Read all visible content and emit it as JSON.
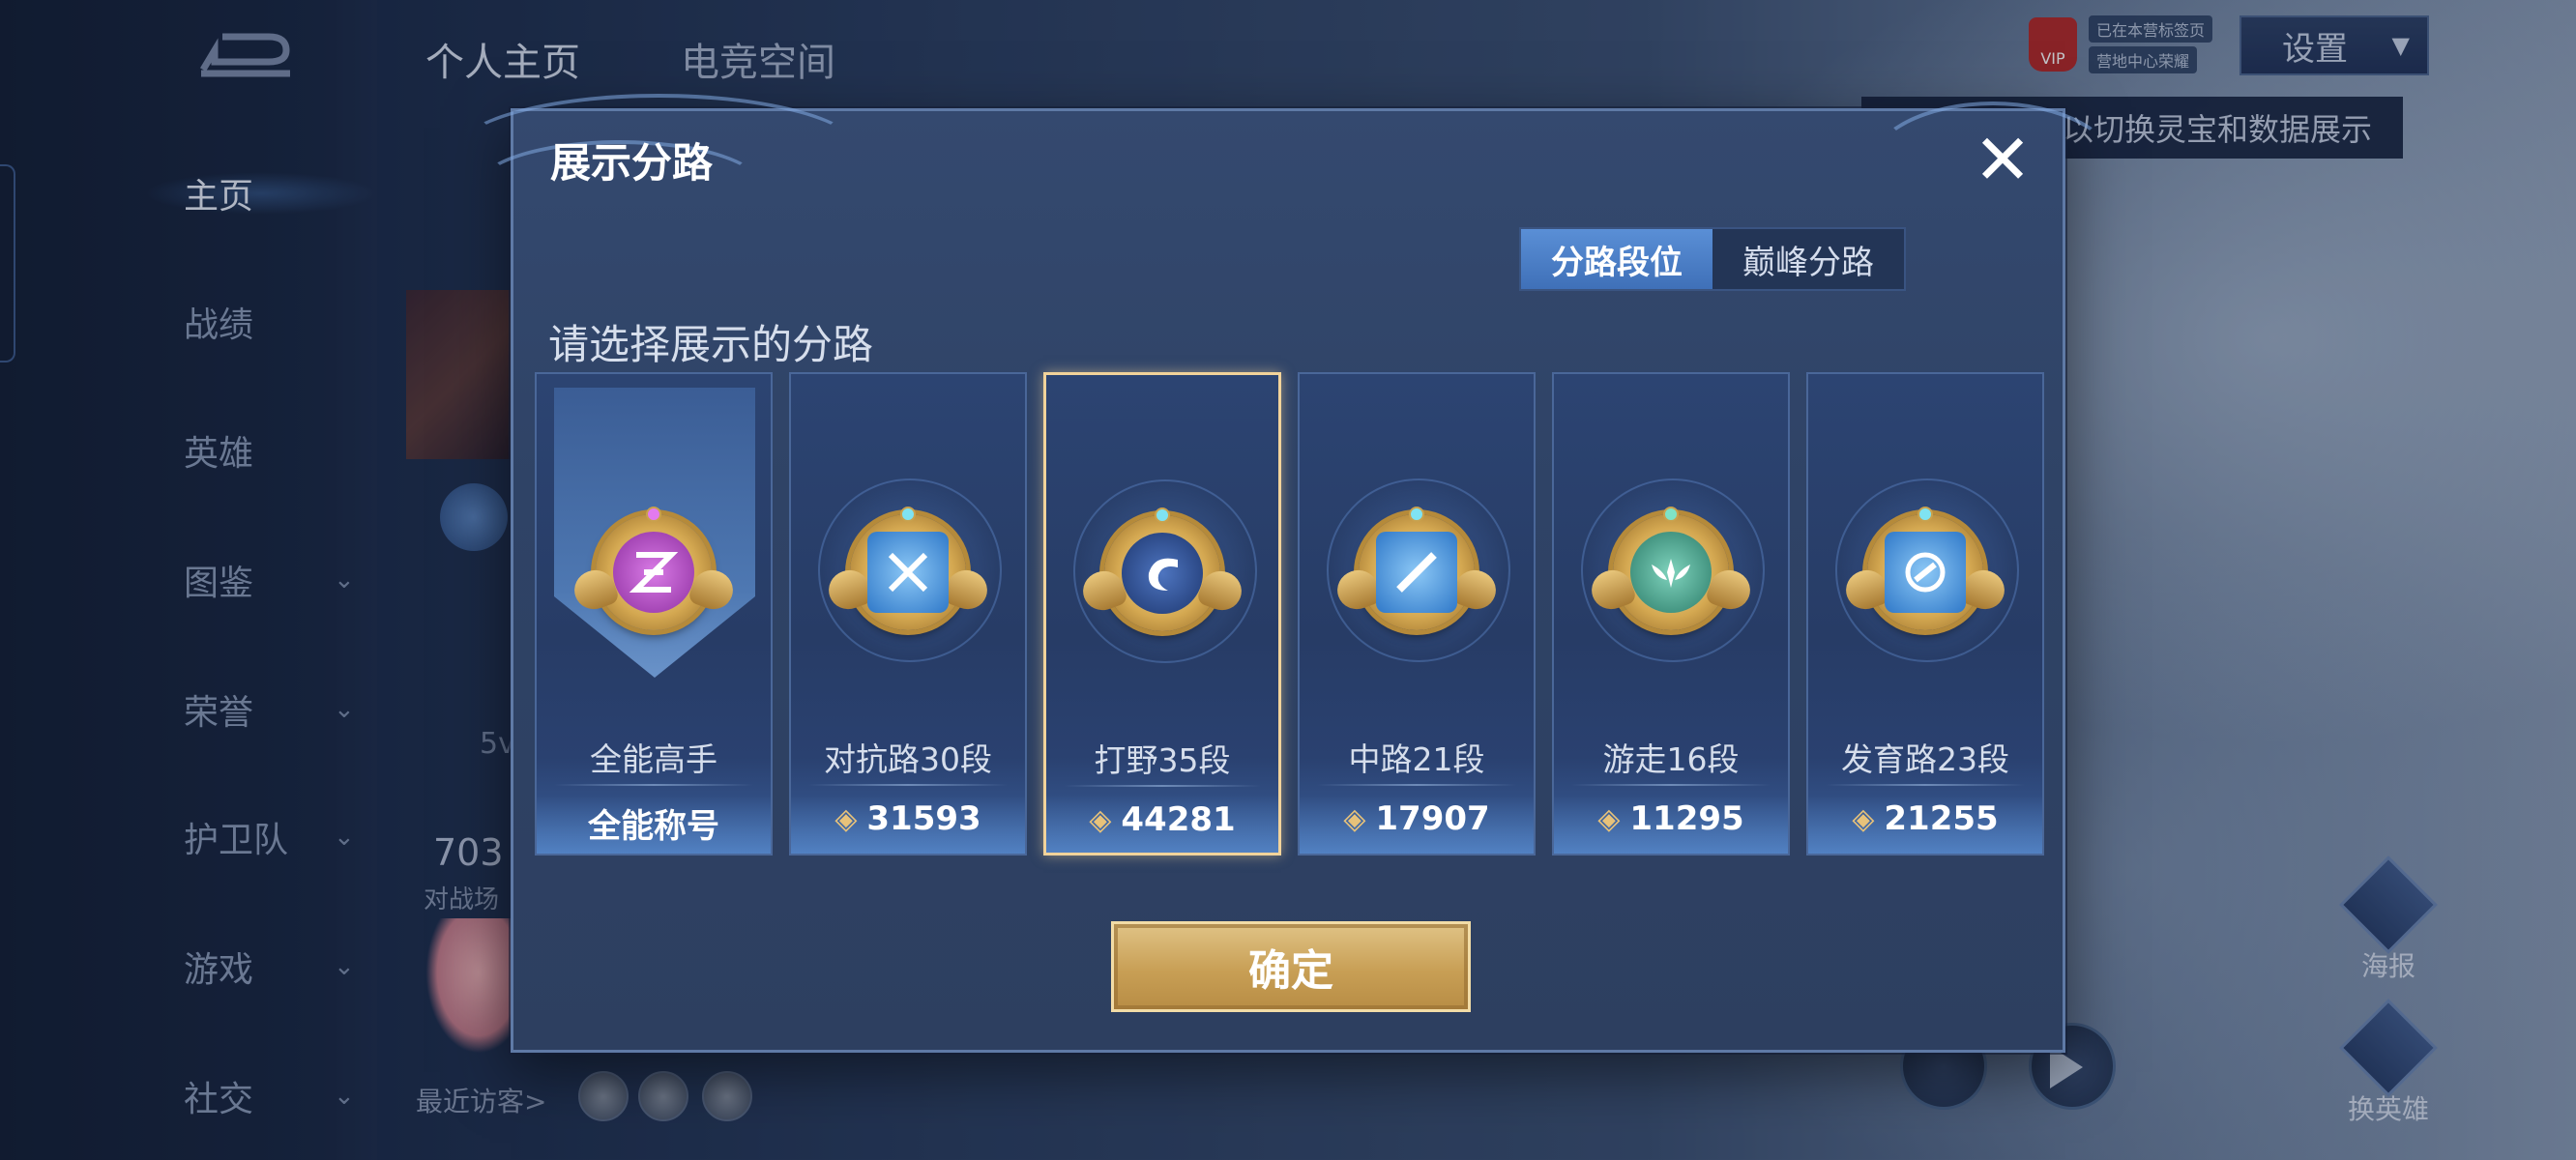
{
  "top_tabs": [
    "个人主页",
    "电竞空间"
  ],
  "nav": [
    {
      "label": "主页",
      "active": true,
      "chevron": false
    },
    {
      "label": "战绩",
      "active": false,
      "chevron": false
    },
    {
      "label": "英雄",
      "active": false,
      "chevron": false
    },
    {
      "label": "图鉴",
      "active": false,
      "chevron": true
    },
    {
      "label": "荣誉",
      "active": false,
      "chevron": true
    },
    {
      "label": "护卫队",
      "active": false,
      "chevron": true
    },
    {
      "label": "游戏",
      "active": false,
      "chevron": true
    },
    {
      "label": "社交",
      "active": false,
      "chevron": true
    }
  ],
  "header": {
    "settings_label": "设置",
    "vip_label": "VIP",
    "vip_line1": "已在本营标签页",
    "vip_line2": "营地中心荣耀",
    "tooltip": "以切换灵宝和数据展示"
  },
  "profile": {
    "stat_5v": "5v",
    "stat_703": "703",
    "stat_label": "对战场",
    "recent_visitors": "最近访客>"
  },
  "right_buttons": [
    "海报",
    "换英雄"
  ],
  "modal": {
    "title": "展示分路",
    "close_icon": "close-icon",
    "toggle": [
      {
        "label": "分路段位",
        "active": true
      },
      {
        "label": "巅峰分路",
        "active": false
      }
    ],
    "subtitle": "请选择展示的分路",
    "confirm_label": "确定",
    "lanes": [
      {
        "label": "全能高手",
        "value": "全能称号",
        "is_title": true,
        "selected": false,
        "color": "#b14fc4",
        "icon": "all-round-emblem-icon"
      },
      {
        "label": "对抗路30段",
        "value": "31593",
        "is_title": false,
        "selected": false,
        "color": "#4f9be8",
        "icon": "clash-lane-emblem-icon"
      },
      {
        "label": "打野35段",
        "value": "44281",
        "is_title": false,
        "selected": true,
        "color": "#2c4d8f",
        "icon": "jungle-dragon-emblem-icon"
      },
      {
        "label": "中路21段",
        "value": "17907",
        "is_title": false,
        "selected": false,
        "color": "#4f9be8",
        "icon": "mid-lane-emblem-icon"
      },
      {
        "label": "游走16段",
        "value": "11295",
        "is_title": false,
        "selected": false,
        "color": "#3f9a86",
        "icon": "roam-wings-emblem-icon"
      },
      {
        "label": "发育路23段",
        "value": "21255",
        "is_title": false,
        "selected": false,
        "color": "#4f9be8",
        "icon": "farm-lane-emblem-icon"
      }
    ]
  },
  "colors": {
    "accent_gold": "#e7c27a",
    "toggle_active": "#4f86cc",
    "modal_bg": "#304468"
  }
}
